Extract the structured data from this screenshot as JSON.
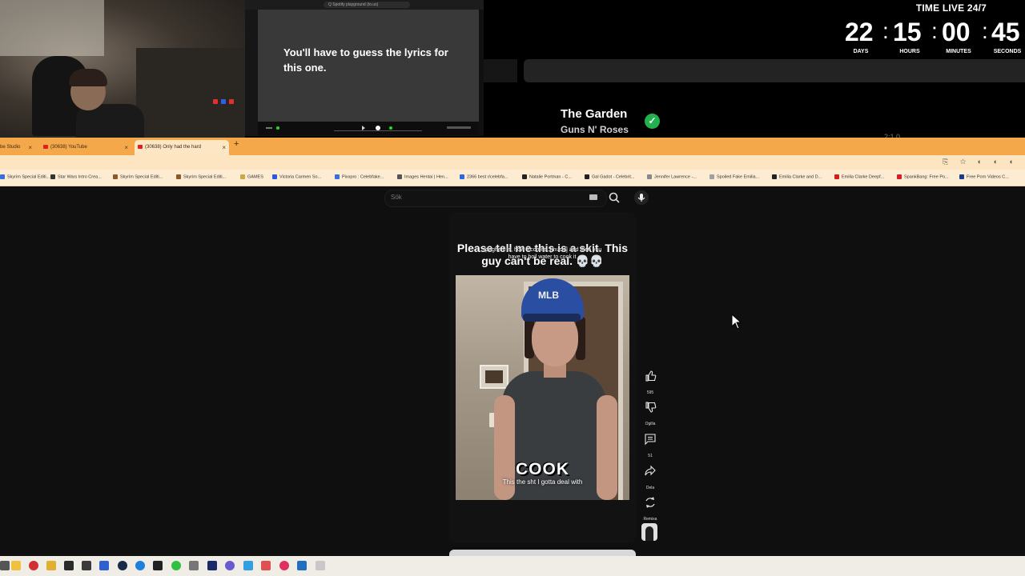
{
  "stream": {
    "mini_window": {
      "url": "Q  Spotify playground (to.us)",
      "lyrics_prompt": "You'll have to guess the lyrics for this one."
    },
    "timer": {
      "title": "TIME LIVE 24/7",
      "days": "22",
      "hours": "15",
      "minutes": "00",
      "seconds": "45",
      "sep": ":",
      "days_label": "DAYS",
      "hours_label": "HOURS",
      "minutes_label": "MINUTES",
      "seconds_label": "SECONDS"
    },
    "now_playing": {
      "title": "The Garden",
      "artist": "Guns N' Roses",
      "check": "✓",
      "faded_text": "2:1 0"
    }
  },
  "browser": {
    "tabs": [
      {
        "label": "be Studio"
      },
      {
        "label": "(30638) YouTube"
      },
      {
        "label": "(30638) Only had the hard"
      }
    ],
    "new_tab": "+",
    "address_icons": "⎘ ☆ ◐ ◐ ◐",
    "bookmarks": [
      {
        "label": "Skyrim Special Editi...",
        "color": "#3a6fd8"
      },
      {
        "label": "Star Wars Intro Crea...",
        "color": "#333333"
      },
      {
        "label": "Skyrim Special Editi...",
        "color": "#8a5a2a"
      },
      {
        "label": "Skyrim Special Editi...",
        "color": "#8a5a2a"
      },
      {
        "label": "GAMES",
        "color": "#c9a84a"
      },
      {
        "label": "Victoria Carmen So...",
        "color": "#2a5ad8"
      },
      {
        "label": "Pixxpro : Celebfake...",
        "color": "#3a6fd8"
      },
      {
        "label": "Images Hentai | Hen...",
        "color": "#555555"
      },
      {
        "label": "2366 best r/celebfa...",
        "color": "#2a6ad8"
      },
      {
        "label": "Natalie Portman - C...",
        "color": "#222222"
      },
      {
        "label": "Gal Gadot - Celebrit...",
        "color": "#222222"
      },
      {
        "label": "Jennifer Lawrence -...",
        "color": "#888888"
      },
      {
        "label": "Spoiled Fake Emilia...",
        "color": "#a0a0a0"
      },
      {
        "label": "Emilia Clarke and D...",
        "color": "#222222"
      },
      {
        "label": "Emilia Clarke Deepf...",
        "color": "#d02020"
      },
      {
        "label": "SpankBang: Free Po...",
        "color": "#d0202a"
      },
      {
        "label": "Free Porn Videos C...",
        "color": "#1a3a8a"
      }
    ]
  },
  "youtube": {
    "search_placeholder": "Sök",
    "short": {
      "caption": "Please tell me this is a skit. This guy can't be real. 💀💀",
      "auto_caption": "spaghetti is, how it comes, [music] and then you have to boil water to cook it",
      "cap_logo": "MLB",
      "big_word": "COOK",
      "subtitle": "This the sht I gotta deal with"
    },
    "actions": {
      "like_count": "595",
      "dislike_label": "Ogilla",
      "comments_count": "51",
      "share_label": "Dela",
      "remix_label": "Remixa"
    }
  },
  "taskbar": {
    "icons": [
      "windows-icon",
      "folder-icon",
      "chrome-icon",
      "files-icon",
      "spotify-icon",
      "terminal-icon",
      "camera-icon",
      "app-icon",
      "steam-icon",
      "edge-icon",
      "text-icon",
      "android-icon",
      "settings-icon",
      "photoshop-icon",
      "obs-icon",
      "notes-icon",
      "tool-icon",
      "opera-icon",
      "vscode-icon",
      "misc-icon"
    ]
  }
}
